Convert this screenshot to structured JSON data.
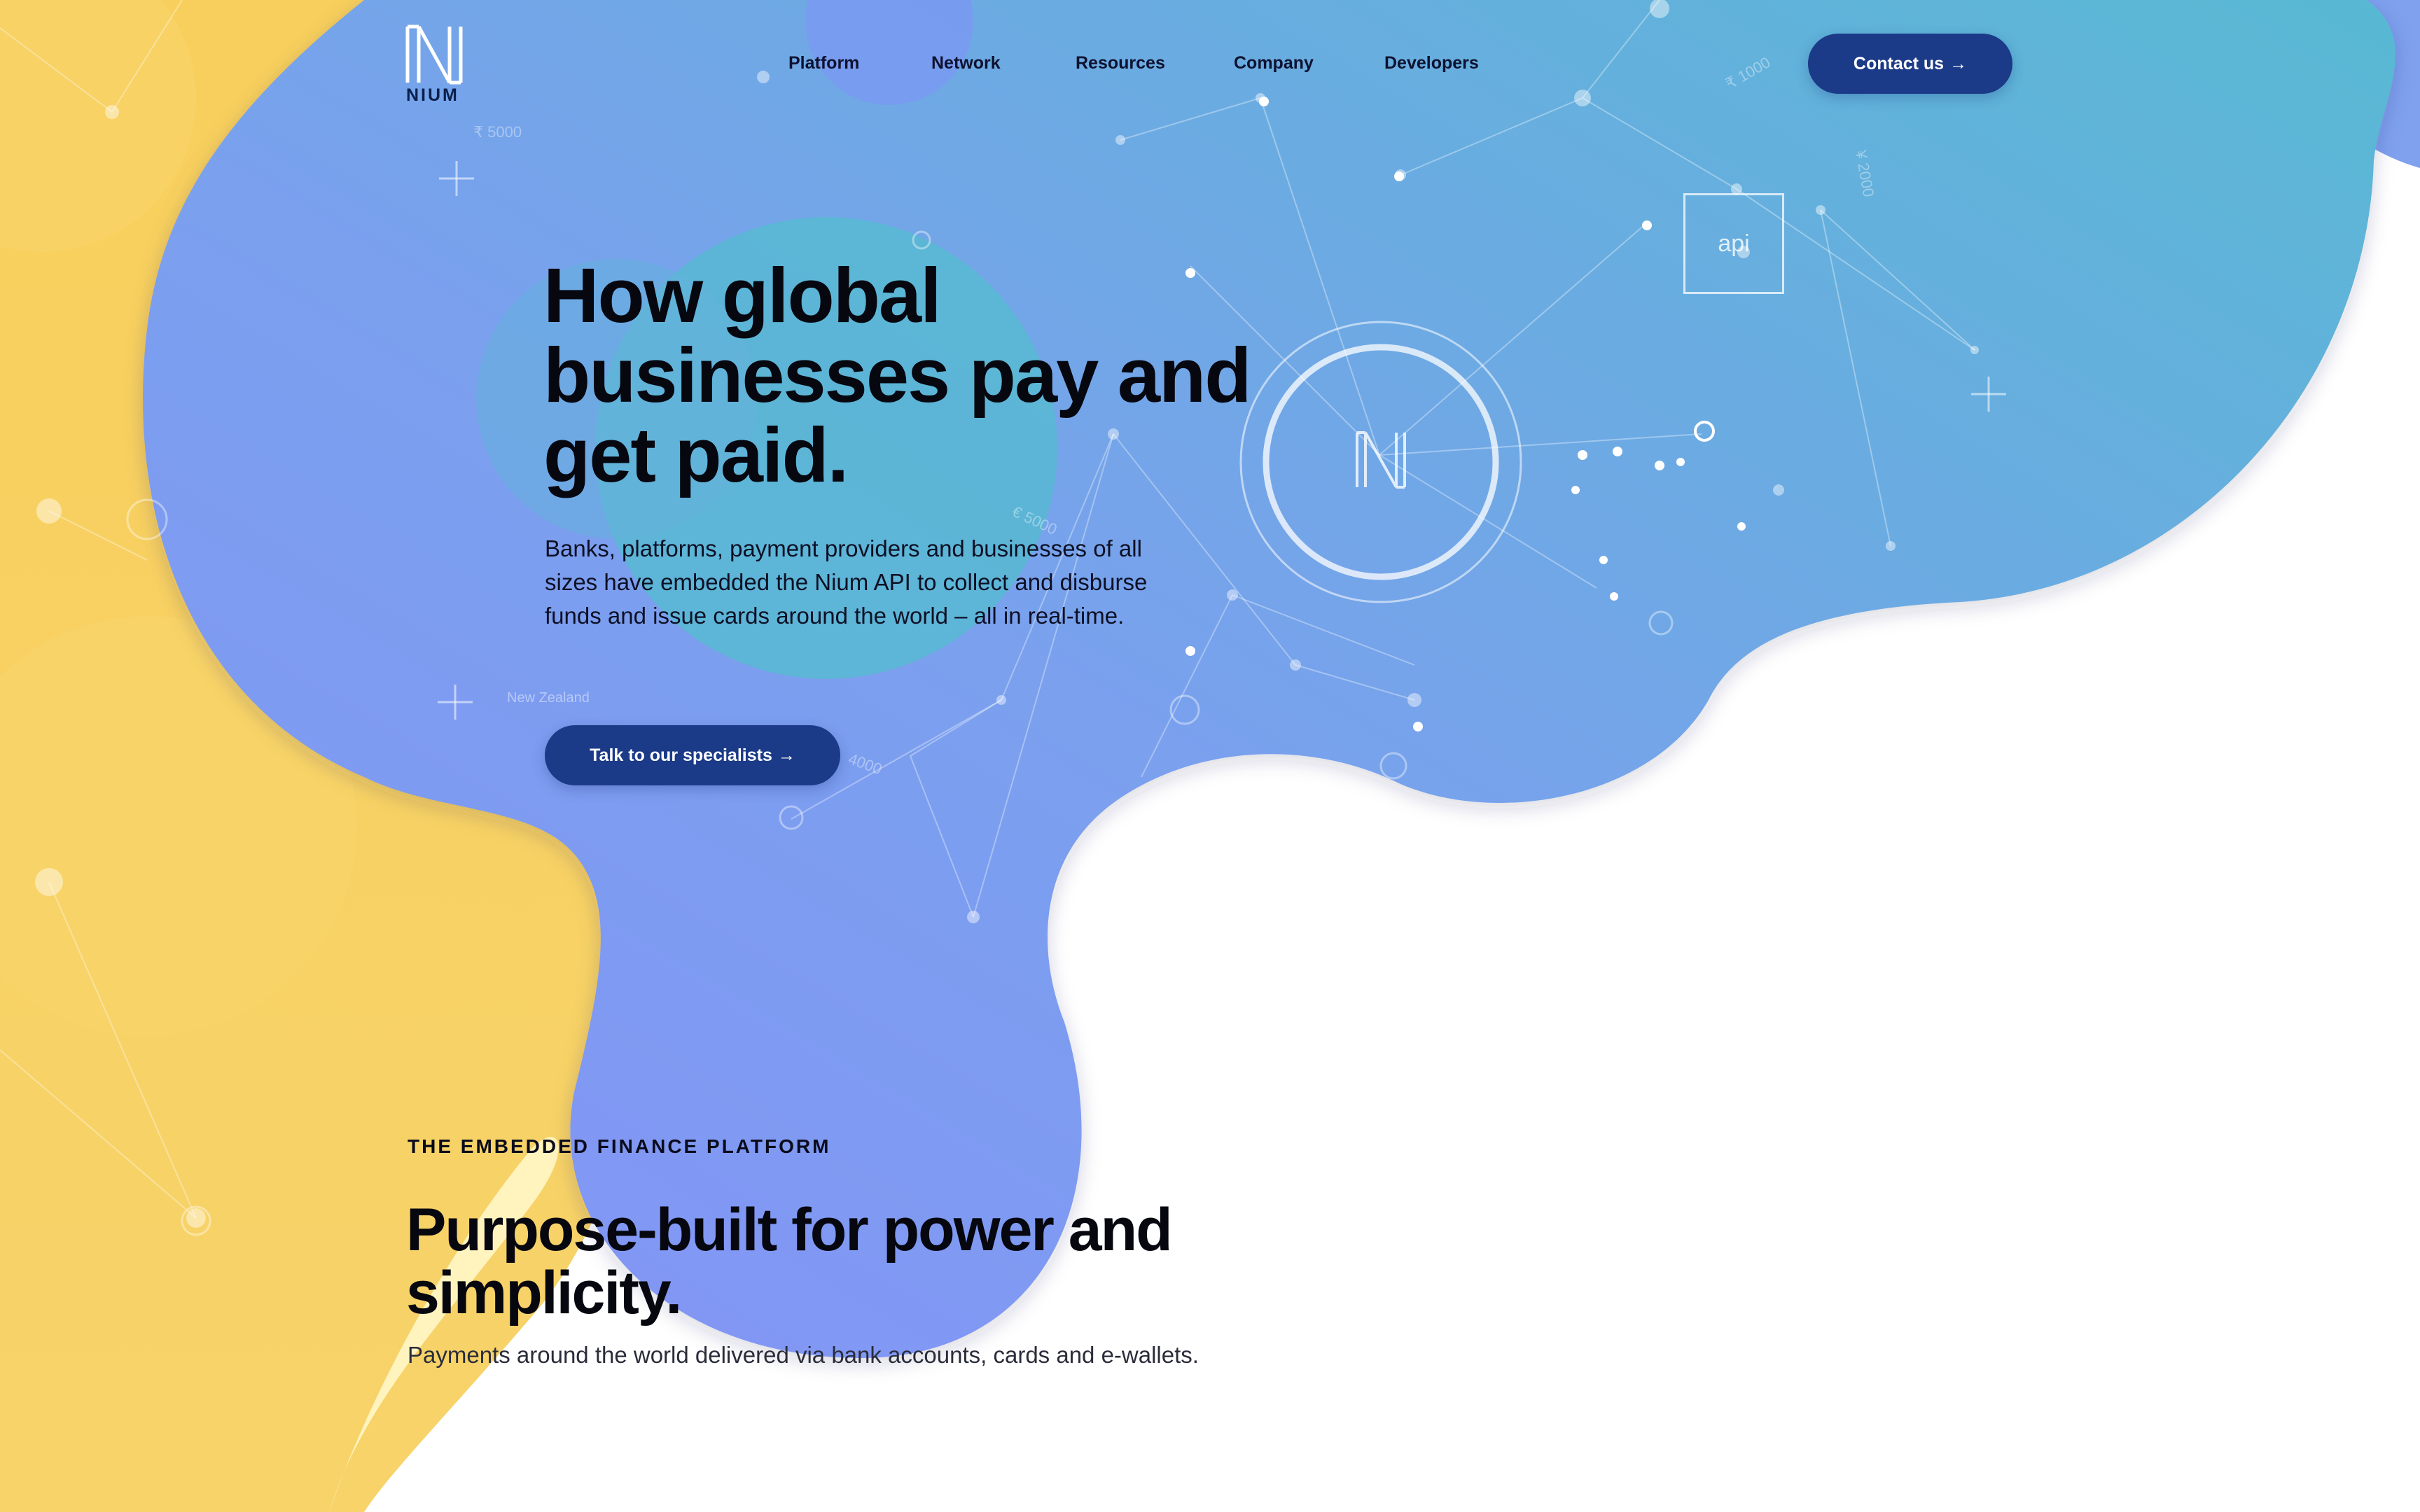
{
  "brand": {
    "name": "NIUM",
    "colors": {
      "navy": "#1b3a87",
      "periwinkle": "#8093f6",
      "teal": "#5ab7d4",
      "yellow": "#f7cc55"
    }
  },
  "header": {
    "nav": [
      {
        "label": "Platform"
      },
      {
        "label": "Network"
      },
      {
        "label": "Resources"
      },
      {
        "label": "Company"
      },
      {
        "label": "Developers"
      }
    ],
    "contact_label": "Contact us",
    "arrow_icon": "arrow-right-icon"
  },
  "hero": {
    "title": "How global businesses pay and get paid.",
    "description": "Banks, platforms, payment providers and businesses of all sizes have embedded the Nium API to collect and disburse funds and issue cards around the world – all in real-time.",
    "cta_label": "Talk to our specialists",
    "map_labels": {
      "api": "api",
      "new_zealand": "New Zealand",
      "rupee": "₹ 5000",
      "rupee_2": "₹ 1000",
      "euro": "€ 5000",
      "yen": "¥ 2000",
      "amount": "4000"
    }
  },
  "section": {
    "eyebrow": "THE EMBEDDED FINANCE PLATFORM",
    "title": "Purpose-built for power and simplicity.",
    "description": "Payments around the world delivered via bank accounts, cards and e-wallets."
  }
}
